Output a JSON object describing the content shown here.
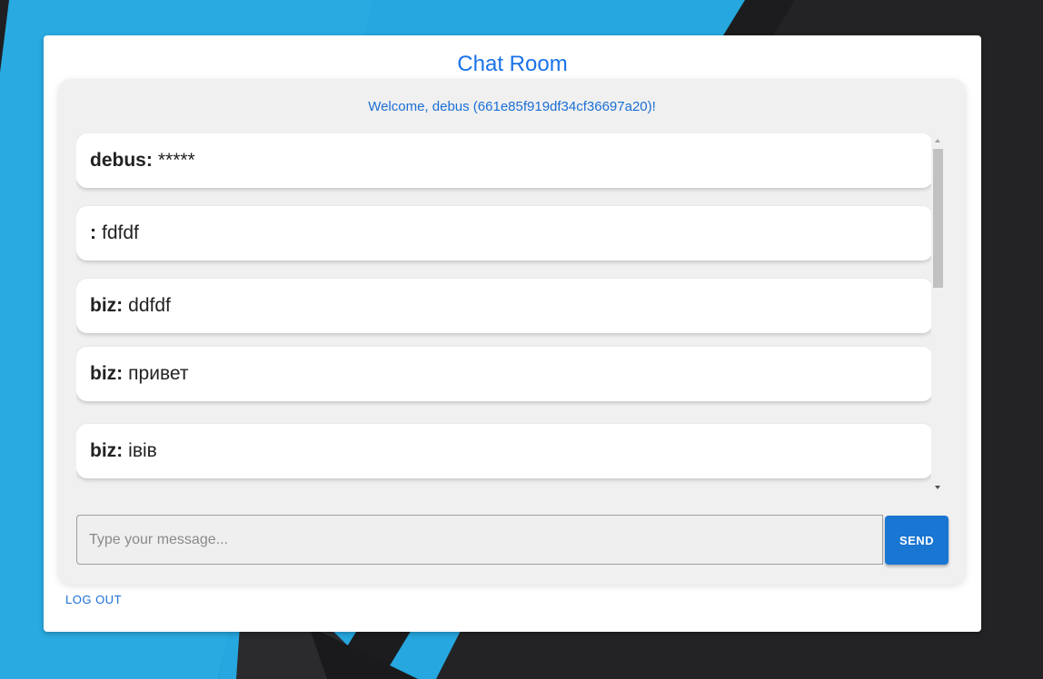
{
  "header": {
    "title": "Chat Room",
    "welcome": "Welcome, debus (661e85f919df34cf36697a20)!"
  },
  "messages": [
    {
      "author": "debus",
      "separator": ":",
      "text": "*****"
    },
    {
      "author": "",
      "separator": ":",
      "text": "fdfdf"
    },
    {
      "author": "biz",
      "separator": ":",
      "text": "ddfdf"
    },
    {
      "author": "biz",
      "separator": ":",
      "text": "привет"
    },
    {
      "author": "biz",
      "separator": ":",
      "text": "івів"
    }
  ],
  "composer": {
    "placeholder": "Type your message...",
    "value": "",
    "send_label": "SEND"
  },
  "footer": {
    "logout_label": "LOG OUT"
  },
  "colors": {
    "accent": "#1976d2",
    "title": "#1a73e8",
    "panel_bg": "#f0f0f0",
    "page_bg_dark": "#232325",
    "page_bg_blue": "#29aae1"
  }
}
